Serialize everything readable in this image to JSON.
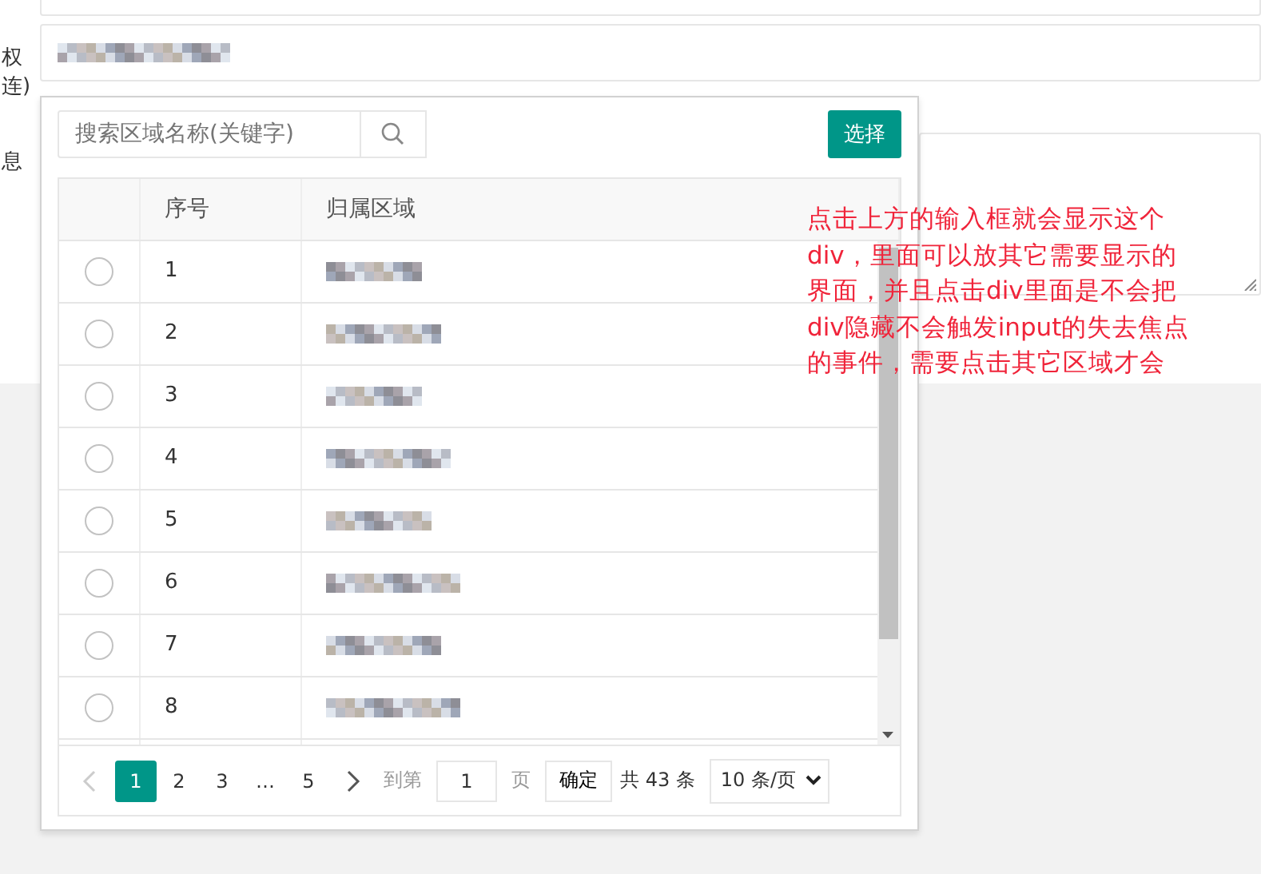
{
  "form": {
    "labels": [
      "权",
      "连)",
      "息"
    ]
  },
  "popup": {
    "search": {
      "placeholder": "搜索区域名称(关键字)"
    },
    "select_button": "选择",
    "table": {
      "columns": [
        "序号",
        "归属区域"
      ],
      "rows": [
        {
          "index": "1",
          "selected": false
        },
        {
          "index": "2",
          "selected": false
        },
        {
          "index": "3",
          "selected": false
        },
        {
          "index": "4",
          "selected": false
        },
        {
          "index": "5",
          "selected": false
        },
        {
          "index": "6",
          "selected": false
        },
        {
          "index": "7",
          "selected": false
        },
        {
          "index": "8",
          "selected": false
        }
      ]
    },
    "pagination": {
      "pages": [
        {
          "label": "1",
          "selected": true
        },
        {
          "label": "2",
          "selected": false
        },
        {
          "label": "3",
          "selected": false
        },
        {
          "label": "…",
          "selected": false
        },
        {
          "label": "5",
          "selected": false
        }
      ],
      "goto_label": "到第",
      "goto_value": "1",
      "page_unit": "页",
      "confirm": "确定",
      "total": "共 43 条",
      "page_size": "10 条/页"
    }
  },
  "annotation": {
    "lines": [
      "点击上方的输入框就会显示这个",
      "div，里面可以放其它需要显示的",
      "界面，并且点击div里面是不会把",
      "div隐藏不会触发input的失去焦点",
      "的事件，需要点击其它区域才会"
    ]
  }
}
